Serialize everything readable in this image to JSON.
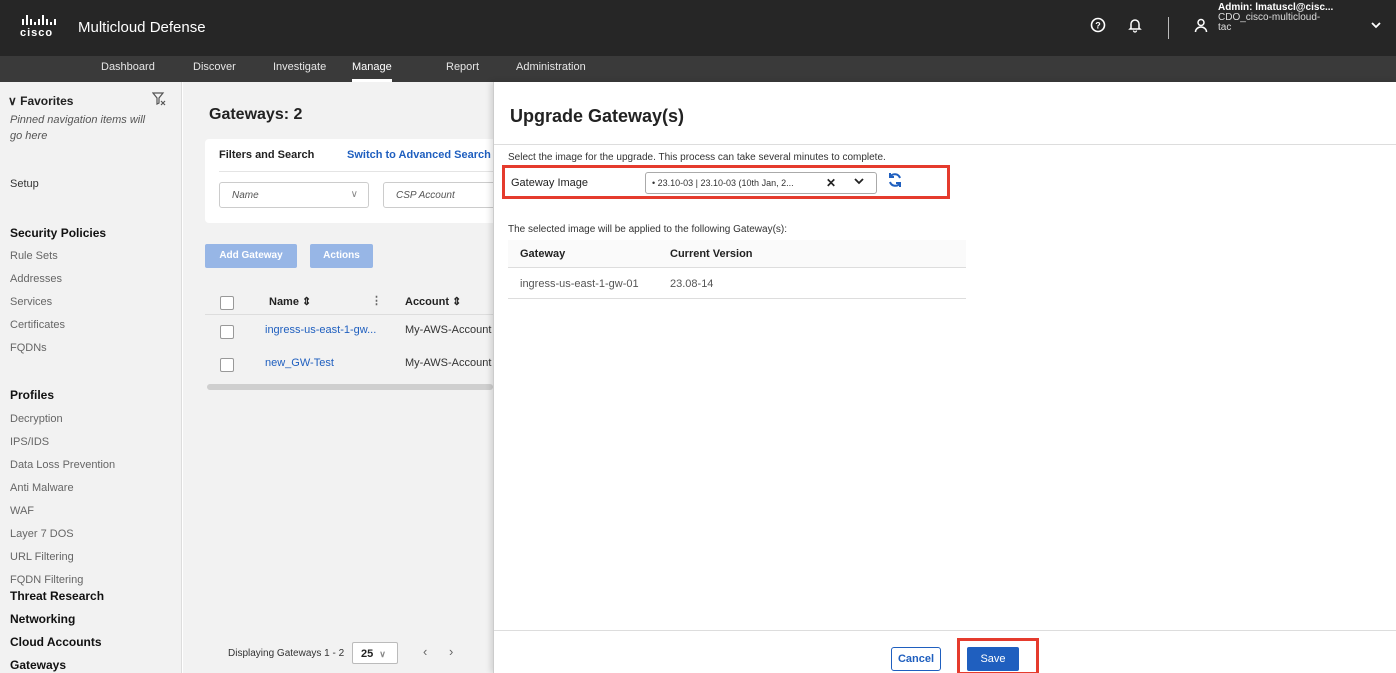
{
  "header": {
    "logo_text": "cisco",
    "app_title": "Multicloud Defense",
    "user_line1": "Admin: lmatuscl@cisc...",
    "user_line2": "CDO_cisco-multicloud-",
    "user_line3": "tac",
    "icons": [
      "help-icon",
      "bell-icon",
      "user-icon",
      "chevron-down-icon"
    ]
  },
  "nav": {
    "items": [
      "Dashboard",
      "Discover",
      "Investigate",
      "Manage",
      "Report",
      "Administration"
    ],
    "active": "Manage"
  },
  "sidebar": {
    "favorites_label": "Favorites",
    "favorites_note": "Pinned navigation items will go here",
    "setup": "Setup",
    "security_policies": "Security Policies",
    "security_items": [
      "Rule Sets",
      "Addresses",
      "Services",
      "Certificates",
      "FQDNs"
    ],
    "profiles": "Profiles",
    "profile_items": [
      "Decryption",
      "IPS/IDS",
      "Data Loss Prevention",
      "Anti Malware",
      "WAF",
      "Layer 7 DOS",
      "URL Filtering",
      "FQDN Filtering"
    ],
    "threat_research": "Threat Research",
    "networking": "Networking",
    "cloud_accounts": "Cloud Accounts",
    "gateways": "Gateways"
  },
  "gateways": {
    "title": "Gateways: 2",
    "filters_label": "Filters and Search",
    "switch_link": "Switch to Advanced Search",
    "name_placeholder": "Name",
    "csp_placeholder": "CSP Account",
    "add_button": "Add Gateway",
    "actions_button": "Actions",
    "columns": [
      "Name",
      "Account"
    ],
    "rows": [
      {
        "name": "ingress-us-east-1-gw...",
        "account": "My-AWS-Account"
      },
      {
        "name": "new_GW-Test",
        "account": "My-AWS-Account"
      }
    ],
    "pager_text": "Displaying Gateways 1 - 2",
    "page_size": "25"
  },
  "drawer": {
    "title": "Upgrade Gateway(s)",
    "description": "Select the image for the upgrade. This process can take several minutes to complete.",
    "image_label": "Gateway Image",
    "image_value": "• 23.10-03 | 23.10-03 (10th Jan, 2...",
    "applied_text": "The selected image will be applied to the following Gateway(s):",
    "table_headers": [
      "Gateway",
      "Current Version"
    ],
    "table_rows": [
      {
        "gateway": "ingress-us-east-1-gw-01",
        "version": "23.08-14"
      }
    ],
    "cancel_label": "Cancel",
    "save_label": "Save"
  },
  "colors": {
    "header_bg": "#262626",
    "nav_bg": "#3a3a3a",
    "link_blue": "#1f5fbf",
    "highlight_red": "#e53b2d",
    "disabled_button": "#97b6e6"
  }
}
